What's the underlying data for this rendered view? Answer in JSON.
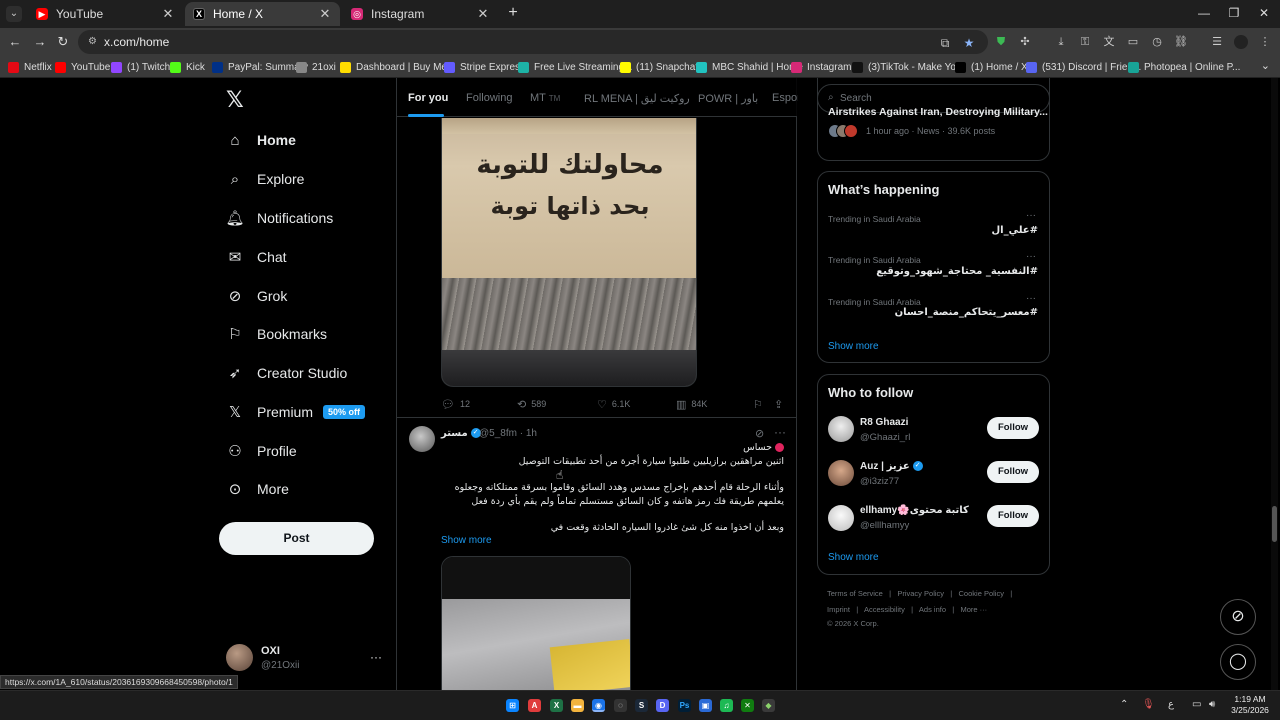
{
  "browser": {
    "tabs": [
      {
        "title": "YouTube",
        "color": "#ff0000"
      },
      {
        "title": "Home / X",
        "color": "#000000"
      },
      {
        "title": "Instagram",
        "color": "#d62976"
      }
    ],
    "url": "x.com/home",
    "bookmarks": [
      {
        "label": "Netflix",
        "color": "#e50914"
      },
      {
        "label": "YouTube",
        "color": "#ff0000"
      },
      {
        "label": "(1) Twitch",
        "color": "#9146ff"
      },
      {
        "label": "Kick",
        "color": "#53fc18"
      },
      {
        "label": "PayPal: Summary",
        "color": "#003087"
      },
      {
        "label": "21oxi",
        "color": "#888888"
      },
      {
        "label": "Dashboard | Buy Me...",
        "color": "#ffdd00"
      },
      {
        "label": "Stripe Express",
        "color": "#635bff"
      },
      {
        "label": "Free Live Streaming...",
        "color": "#1db3a6"
      },
      {
        "label": "(11) Snapchat",
        "color": "#fffc00"
      },
      {
        "label": "MBC Shahid | Home",
        "color": "#21c3c0"
      },
      {
        "label": "Instagram",
        "color": "#d62976"
      },
      {
        "label": "(3)TikTok - Make Yo...",
        "color": "#111111"
      },
      {
        "label": "(1) Home / X",
        "color": "#000000"
      },
      {
        "label": "(531) Discord | Frien...",
        "color": "#5865f2"
      },
      {
        "label": "Photopea | Online P...",
        "color": "#18a497"
      }
    ]
  },
  "nav": {
    "items": [
      {
        "label": "Home",
        "icon": "home-icon"
      },
      {
        "label": "Explore",
        "icon": "search-icon"
      },
      {
        "label": "Notifications",
        "icon": "bell-icon"
      },
      {
        "label": "Chat",
        "icon": "mail-icon"
      },
      {
        "label": "Grok",
        "icon": "grok-icon"
      },
      {
        "label": "Bookmarks",
        "icon": "bookmark-icon"
      },
      {
        "label": "Creator Studio",
        "icon": "rocket-icon"
      },
      {
        "label": "Premium",
        "icon": "x-logo-icon"
      },
      {
        "label": "Profile",
        "icon": "person-icon"
      },
      {
        "label": "More",
        "icon": "more-circle-icon"
      }
    ],
    "premium_badge": "50% off",
    "post_button": "Post",
    "account": {
      "name": "OXI",
      "handle": "@21Oxii"
    }
  },
  "feed": {
    "tabs": [
      "For you",
      "Following",
      "MT",
      "RL MENA | روكيت ليق",
      "POWR | باور",
      "Espor"
    ],
    "mt_suffix": "TM",
    "image1_text": [
      "محاولتك للتوبة",
      "بحد ذاتها توبة"
    ],
    "tweet1_stats": {
      "replies": "12",
      "reposts": "589",
      "likes": "6.1K",
      "views": "84K"
    },
    "tweet2": {
      "name": "مستر",
      "handle": "@5_8fm",
      "time": "1h",
      "lines": [
        "حساس",
        "اثنين مراهقين برازيليين طلبوا سيارة أجرة من أحد تطبيقات التوصيل",
        "وأثناء الرحلة قام أحدهم بإخراج مسدس وهدد السائق وقاموا بسرقة ممتلكاته وجعلوه",
        "يعلمهم طريقة فك رمز هاتفه و كان السائق مستسلم تماماً ولم يقم بأي ردة فعل",
        "وبعد أن اخذوا منه كل شئ غادروا السياره الحادثة وقعت في"
      ],
      "show_more": "Show more"
    }
  },
  "sidebar": {
    "search_placeholder": "Search",
    "news": {
      "title": "Airstrikes Against Iran, Destroying Military...",
      "meta": "1 hour ago · News · 39.6K posts"
    },
    "happening": {
      "title": "What’s happening",
      "trends": [
        {
          "location": "Trending in Saudi Arabia",
          "tag": "#علي_ال"
        },
        {
          "location": "Trending in Saudi Arabia",
          "tag": "#النفسية_  محتاجة_شهود_وتوقيع"
        },
        {
          "location": "Trending in Saudi Arabia",
          "tag": "#معسر_يتحاكم_منصة_احسان"
        }
      ],
      "show_more": "Show more"
    },
    "who_to_follow": {
      "title": "Who to follow",
      "accounts": [
        {
          "name": "R8 Ghaazi",
          "handle": "@Ghaazi_rl",
          "verified": false
        },
        {
          "name": "Auz | عزيز",
          "handle": "@i3ziz77",
          "verified": true
        },
        {
          "name": "ellhamy🌸كاتبة محتوى",
          "handle": "@elllhamyy",
          "verified": false
        }
      ],
      "follow_label": "Follow",
      "show_more": "Show more"
    },
    "footer": {
      "row1": [
        "Terms of Service",
        "|",
        "Privacy Policy",
        "|",
        "Cookie Policy",
        "|"
      ],
      "row2": [
        "Imprint",
        "|",
        "Accessibility",
        "|",
        "Ads info",
        "|",
        "More ···"
      ],
      "copyright": "© 2026 X Corp."
    }
  },
  "status_url": "https://x.com/1A_610/status/2036169309668450598/photo/1",
  "taskbar": {
    "time": "1:19 AM",
    "date": "3/25/2026",
    "lang": "ع"
  }
}
